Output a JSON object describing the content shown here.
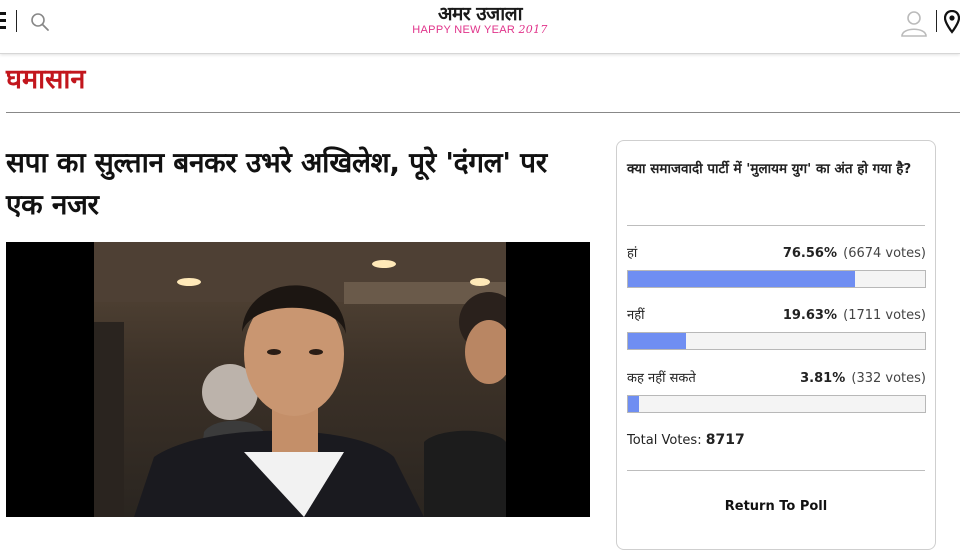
{
  "header": {
    "logo_main": "अमर उजाला",
    "logo_sub_text": "HAPPY NEW YEAR",
    "logo_sub_year": "2017",
    "icons": [
      "menu-icon",
      "search-icon",
      "user-icon",
      "location-icon"
    ]
  },
  "section": {
    "title": "घमासान"
  },
  "article": {
    "headline": "सपा का सुल्तान बनकर उभरे अखिलेश, पूरे 'दंगल' पर एक नजर"
  },
  "poll": {
    "question": "क्या समाजवादी पार्टी में 'मुलायम युग' का अंत हो गया है?",
    "options": [
      {
        "label": "हां",
        "percent_text": "76.56%",
        "votes_text": "(6674 votes)",
        "fraction": 0.7656
      },
      {
        "label": "नहीं",
        "percent_text": "19.63%",
        "votes_text": "(1711 votes)",
        "fraction": 0.1963
      },
      {
        "label": "कह नहीं सकते",
        "percent_text": "3.81%",
        "votes_text": "(332 votes)",
        "fraction": 0.0381
      }
    ],
    "total_label": "Total Votes:",
    "total_value": "8717",
    "return_label": "Return To Poll",
    "bar_color": "#6f8ef2"
  },
  "colors": {
    "section_red": "#c2161d",
    "logo_pink": "#e0338a"
  }
}
